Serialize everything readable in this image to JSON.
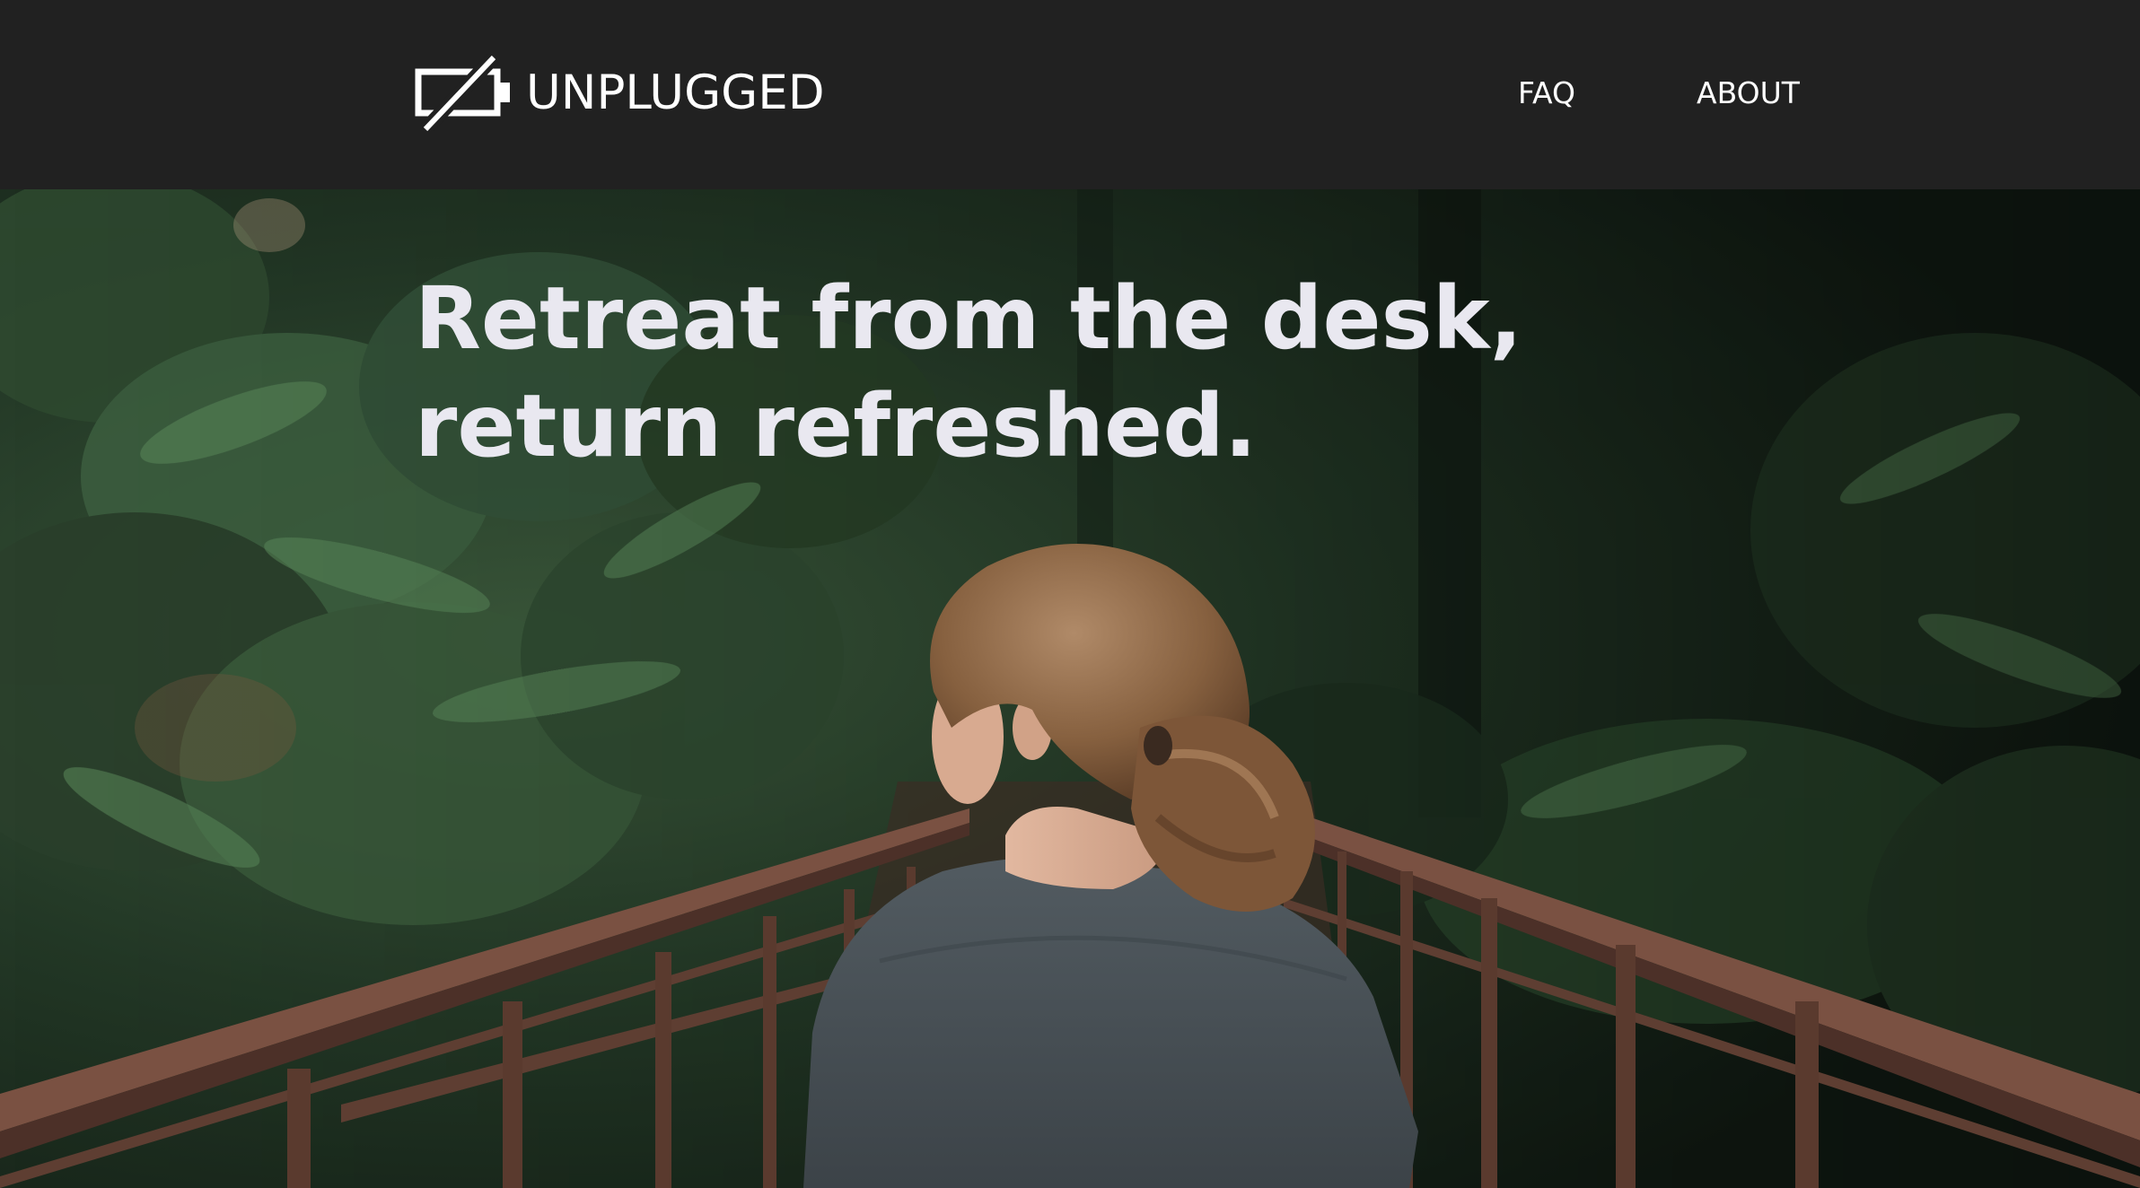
{
  "header": {
    "brand_name": "UNPLUGGED",
    "logo_icon": "battery-off-icon",
    "nav": [
      {
        "label": "FAQ"
      },
      {
        "label": "ABOUT"
      }
    ]
  },
  "hero": {
    "headline": "Retreat from the desk, return refreshed.",
    "photo_subject": "woman-on-forest-bridge-photo"
  },
  "colors": {
    "header_bg": "#212121",
    "nav_text": "#ffffff",
    "headline_text": "#e9e8f0",
    "forest_dark": "#1c2a1e",
    "railing": "#6e4a3c",
    "shirt": "#4a5257",
    "hair": "#8a6446"
  }
}
